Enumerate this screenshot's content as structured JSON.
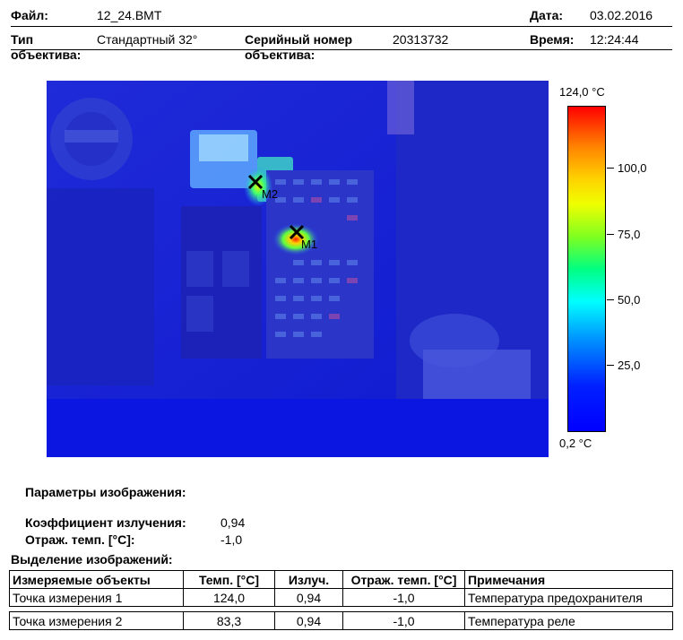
{
  "header": {
    "file_label": "Файл:",
    "file_value": "12_24.BMT",
    "date_label": "Дата:",
    "date_value": "03.02.2016",
    "lens_type_label_1": "Тип",
    "lens_type_label_2": "объектива:",
    "lens_type_value": "Стандартный 32°",
    "serial_label_1": "Серийный номер",
    "serial_label_2": "объектива:",
    "serial_value": "20313732",
    "time_label": "Время:",
    "time_value": "12:24:44"
  },
  "thermal_image": {
    "markers": [
      {
        "label": "M1",
        "icon": "cross-marker-icon"
      },
      {
        "label": "M2",
        "icon": "cross-marker-icon"
      }
    ]
  },
  "scale": {
    "max_label": "124,0 °C",
    "min_label": "0,2 °C",
    "ticks": [
      "100,0",
      "75,0",
      "50,0",
      "25,0"
    ],
    "colors": {
      "hot": "#ff0000",
      "cold": "#0000ff"
    }
  },
  "params": {
    "title": "Параметры изображения:",
    "emissivity_label": "Коэффициент излучения:",
    "emissivity_value": "0,94",
    "refl_label": "Отраж. темп. [°C]:",
    "refl_value": "-1,0"
  },
  "selection": {
    "title": "Выделение изображений:",
    "columns": [
      "Измеряемые объекты",
      "Темп. [°C]",
      "Излуч.",
      "Отраж. темп. [°C]",
      "Примечания"
    ],
    "rows": [
      [
        "Точка измерения 1",
        "124,0",
        "0,94",
        "-1,0",
        "Температура предохранителя"
      ],
      [
        "Точка измерения 2",
        "83,3",
        "0,94",
        "-1,0",
        "Температура реле"
      ]
    ]
  }
}
